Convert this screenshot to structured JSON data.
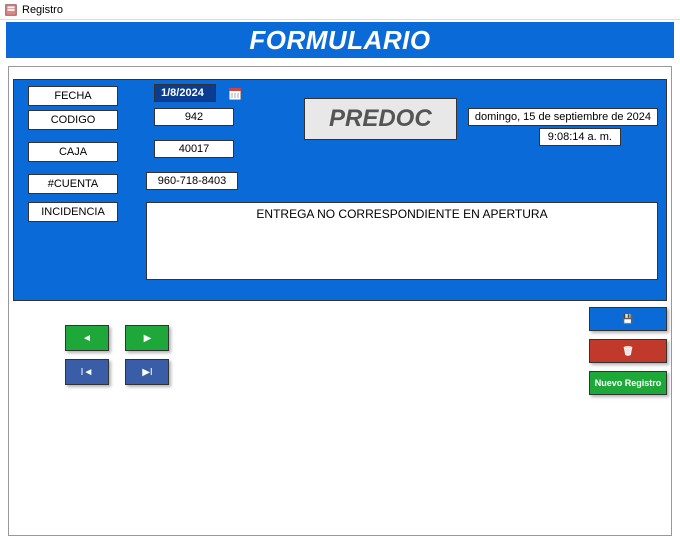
{
  "window": {
    "title": "Registro"
  },
  "header": {
    "title": "FORMULARIO"
  },
  "form": {
    "labels": {
      "fecha": "FECHA",
      "codigo": "CODIGO",
      "caja": "CAJA",
      "cuenta": "#CUENTA",
      "incidencia": "INCIDENCIA"
    },
    "values": {
      "fecha": "1/8/2024",
      "codigo": "942",
      "caja": "40017",
      "cuenta": "960-718-8403",
      "incidencia": "ENTREGA NO CORRESPONDIENTE EN APERTURA"
    },
    "predoc": "PREDOC",
    "current_date": "domingo, 15 de septiembre de 2024",
    "current_time": "9:08:14 a. m."
  },
  "nav": {
    "prev": "◄",
    "next": "▶",
    "first": "I◄",
    "last": "▶I"
  },
  "actions": {
    "save_icon": "💾",
    "delete_icon": "🗑",
    "nuevo": "Nuevo Registro"
  }
}
